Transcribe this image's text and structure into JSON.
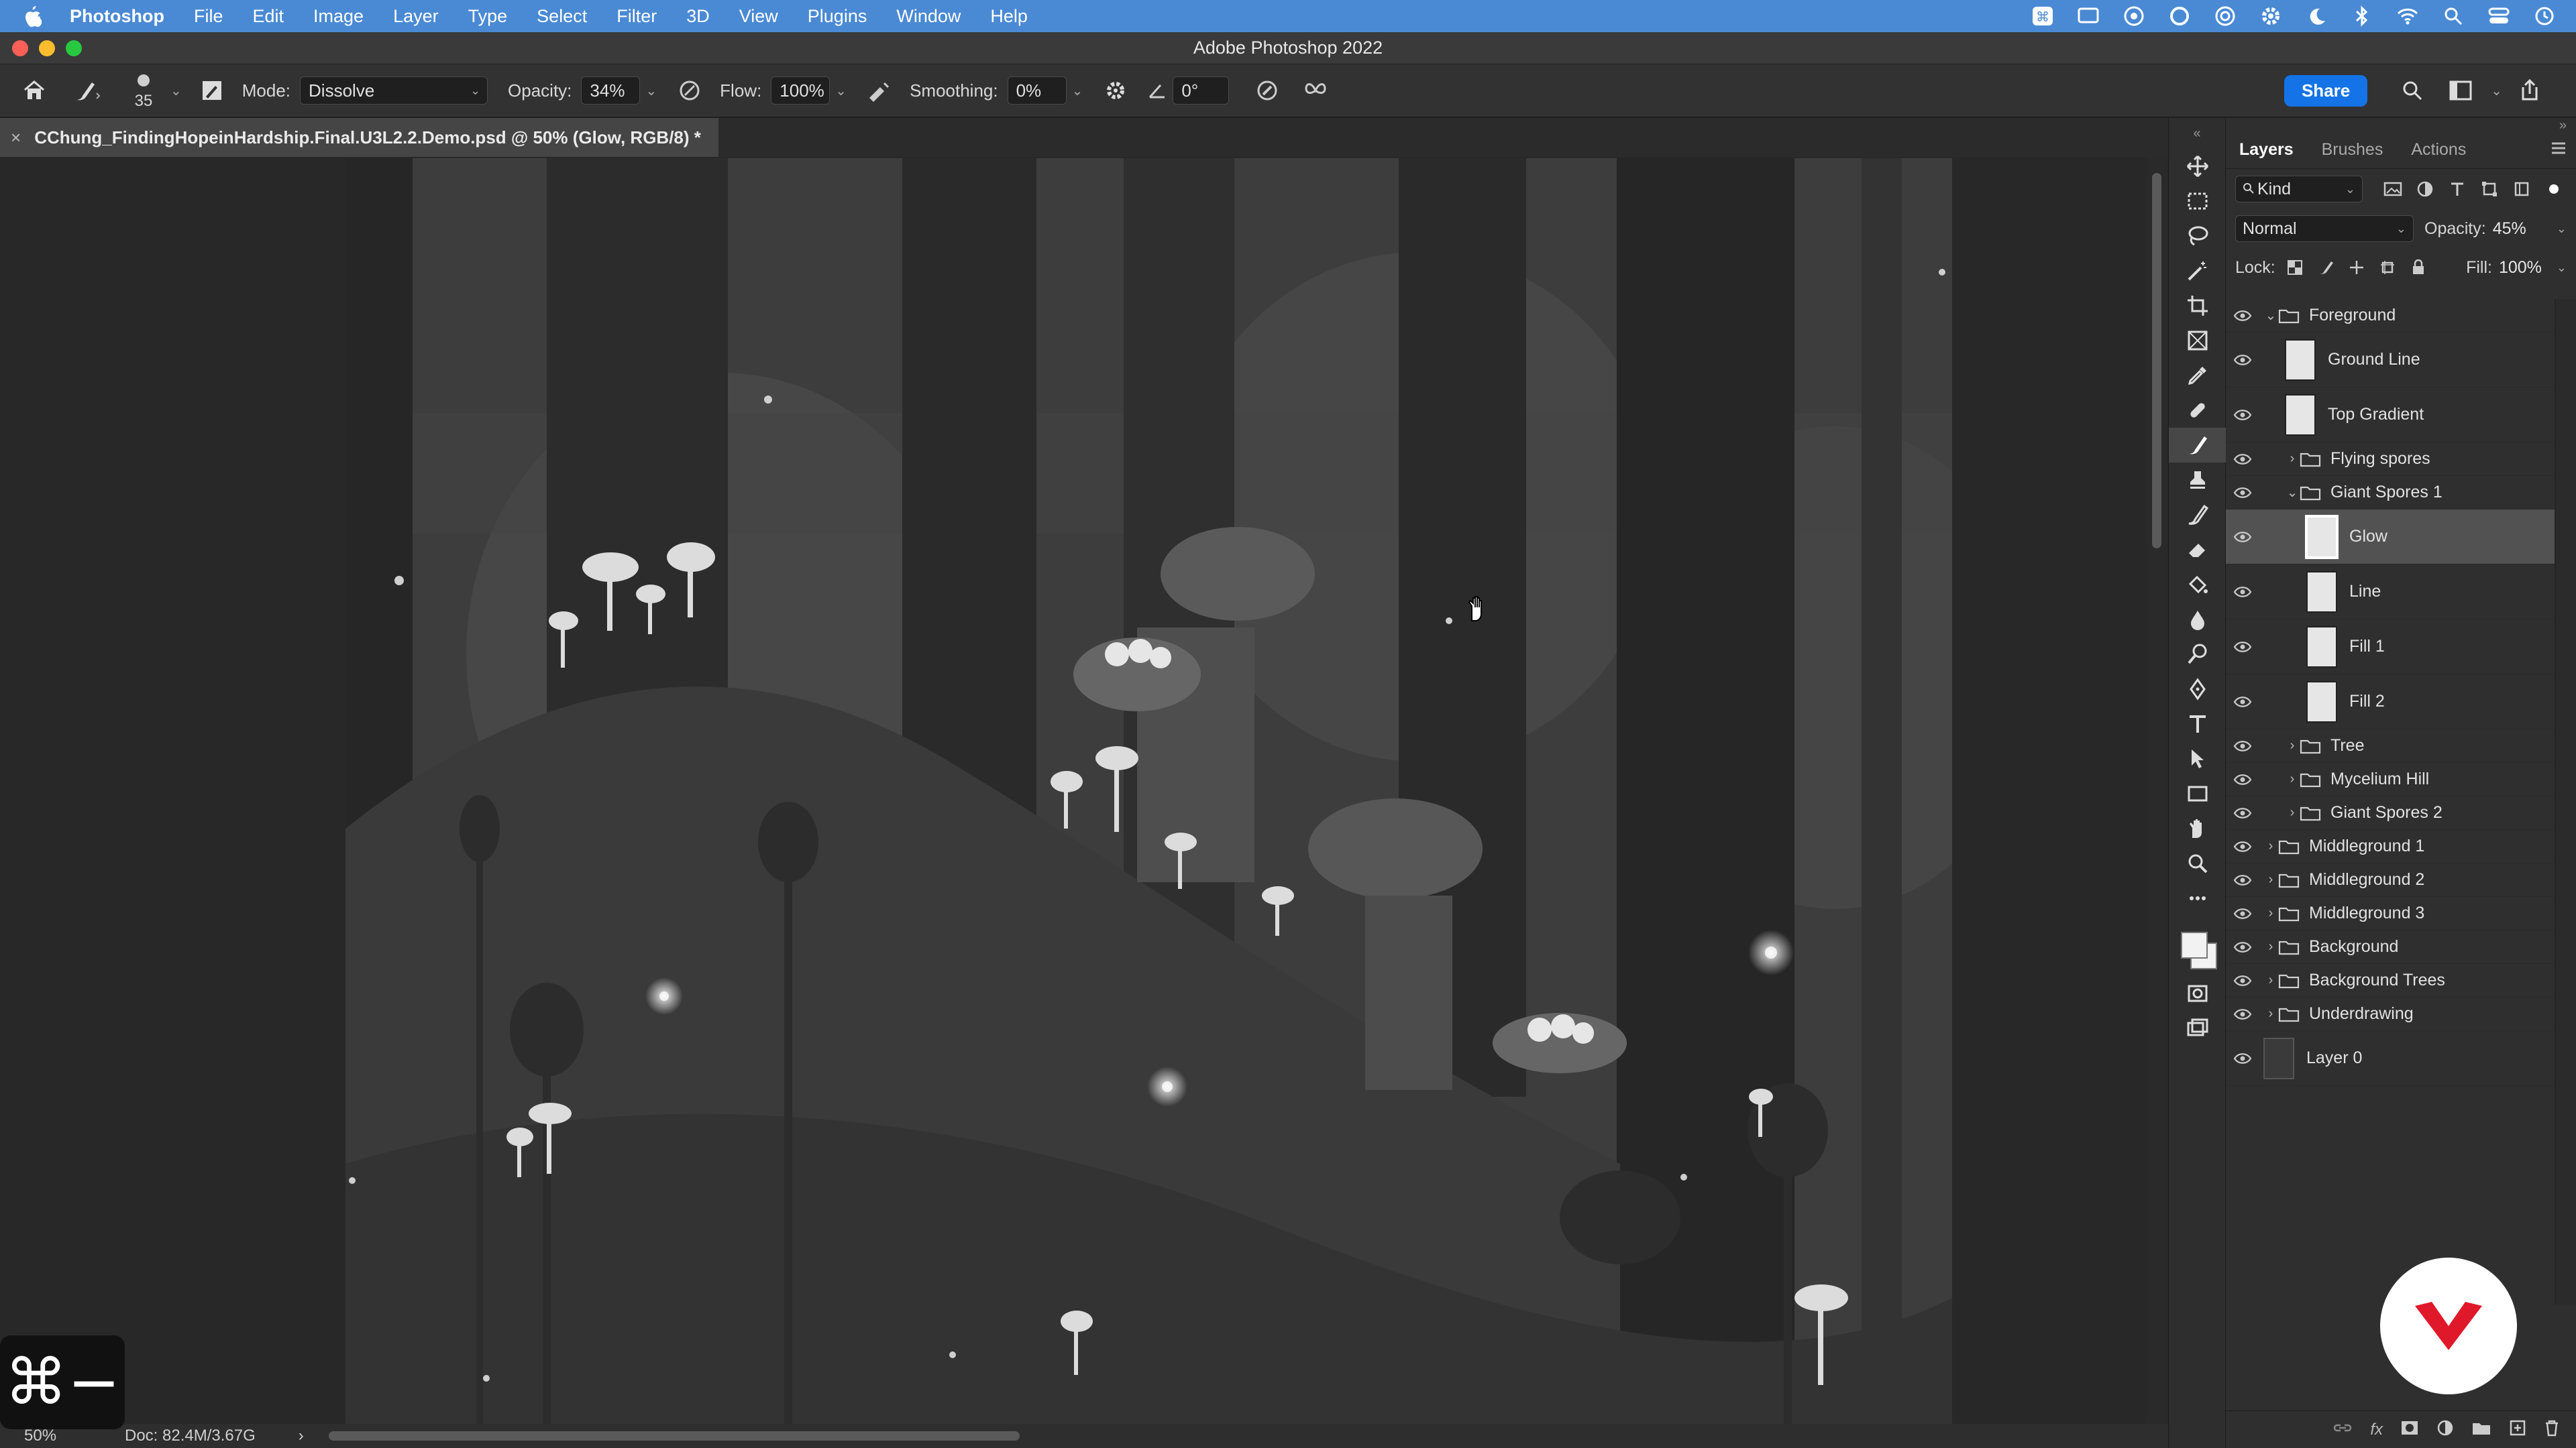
{
  "menubar": {
    "app": "Photoshop",
    "items": [
      "File",
      "Edit",
      "Image",
      "Layer",
      "Type",
      "Select",
      "Filter",
      "3D",
      "View",
      "Plugins",
      "Window",
      "Help"
    ],
    "status_icons": [
      "command-icon",
      "screen-mirror-icon",
      "creative-cloud-icon",
      "sync-icon",
      "accessibility-icon",
      "settings-gear-icon",
      "moon-icon",
      "bluetooth-icon",
      "wifi-icon",
      "search-icon",
      "control-center-icon",
      "clock-icon"
    ]
  },
  "window": {
    "title": "Adobe Photoshop 2022"
  },
  "options": {
    "brush_size": "35",
    "mode_label": "Mode:",
    "mode_value": "Dissolve",
    "opacity_label": "Opacity:",
    "opacity_value": "34%",
    "flow_label": "Flow:",
    "flow_value": "100%",
    "smoothing_label": "Smoothing:",
    "smoothing_value": "0%",
    "angle_value": "0°",
    "share_label": "Share"
  },
  "document": {
    "tab_close": "×",
    "tab_title": "CChung_FindingHopeinHardship.Final.U3L2.2.Demo.psd @ 50% (Glow, RGB/8) *"
  },
  "statusbar": {
    "zoom": "50%",
    "doc_info": "Doc: 82.4M/3.67G",
    "arrow": "›"
  },
  "shortcut_overlay": "⌘−",
  "panels": {
    "tabs": [
      "Layers",
      "Brushes",
      "Actions"
    ],
    "filter_kind": "Kind",
    "blend_mode": "Normal",
    "opacity_label": "Opacity:",
    "opacity_value": "45%",
    "lock_label": "Lock:",
    "fill_label": "Fill:",
    "fill_value": "100%"
  },
  "layers": [
    {
      "name": "Foreground",
      "type": "group",
      "indent": 0,
      "expanded": true
    },
    {
      "name": "Ground Line",
      "type": "layer",
      "indent": 1
    },
    {
      "name": "Top Gradient",
      "type": "layer",
      "indent": 1
    },
    {
      "name": "Flying spores",
      "type": "group",
      "indent": 1,
      "expanded": false
    },
    {
      "name": "Giant Spores 1",
      "type": "group",
      "indent": 1,
      "expanded": true
    },
    {
      "name": "Glow",
      "type": "layer",
      "indent": 2,
      "selected": true
    },
    {
      "name": "Line",
      "type": "layer",
      "indent": 2
    },
    {
      "name": "Fill 1",
      "type": "layer",
      "indent": 2
    },
    {
      "name": "Fill 2",
      "type": "layer",
      "indent": 2
    },
    {
      "name": "Tree",
      "type": "group",
      "indent": 1,
      "expanded": false
    },
    {
      "name": "Mycelium Hill",
      "type": "group",
      "indent": 1,
      "expanded": false
    },
    {
      "name": "Giant Spores 2",
      "type": "group",
      "indent": 1,
      "expanded": false
    },
    {
      "name": "Middleground 1",
      "type": "group",
      "indent": 0,
      "expanded": false
    },
    {
      "name": "Middleground 2",
      "type": "group",
      "indent": 0,
      "expanded": false
    },
    {
      "name": "Middleground 3",
      "type": "group",
      "indent": 0,
      "expanded": false
    },
    {
      "name": "Background",
      "type": "group",
      "indent": 0,
      "expanded": false
    },
    {
      "name": "Background Trees",
      "type": "group",
      "indent": 0,
      "expanded": false
    },
    {
      "name": "Underdrawing",
      "type": "group",
      "indent": 0,
      "expanded": false
    },
    {
      "name": "Layer 0",
      "type": "layer",
      "indent": 0,
      "dark": true
    }
  ],
  "colors": {
    "menubar": "#4a8ad4",
    "accent": "#1473e6",
    "badge_red": "#e0192a"
  }
}
